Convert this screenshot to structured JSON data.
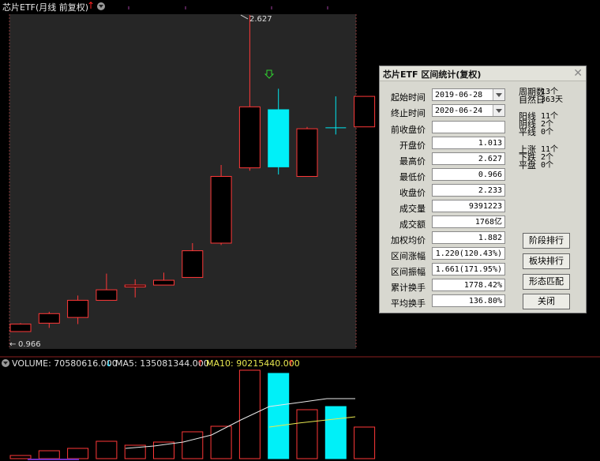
{
  "header": {
    "title": "芯片ETF(月线 前复权)"
  },
  "chart": {
    "high_label": "2.627",
    "low_label": "0.966"
  },
  "chart_data": {
    "type": "candlestick",
    "price_candles": [
      {
        "o": 0.966,
        "c": 1.005,
        "h": 1.01,
        "l": 0.966
      },
      {
        "o": 1.01,
        "c": 1.06,
        "h": 1.07,
        "l": 0.985
      },
      {
        "o": 1.04,
        "c": 1.13,
        "h": 1.155,
        "l": 1.005
      },
      {
        "o": 1.13,
        "c": 1.185,
        "h": 1.27,
        "l": 1.13
      },
      {
        "o": 1.2,
        "c": 1.21,
        "h": 1.24,
        "l": 1.145
      },
      {
        "o": 1.21,
        "c": 1.235,
        "h": 1.275,
        "l": 1.21
      },
      {
        "o": 1.25,
        "c": 1.39,
        "h": 1.43,
        "l": 1.25
      },
      {
        "o": 1.43,
        "c": 1.78,
        "h": 1.84,
        "l": 1.42
      },
      {
        "o": 1.825,
        "c": 2.145,
        "h": 2.627,
        "l": 1.81
      },
      {
        "o": 2.13,
        "c": 1.83,
        "h": 2.24,
        "l": 1.79
      },
      {
        "o": 1.78,
        "c": 2.03,
        "h": 2.04,
        "l": 1.78
      },
      {
        "o": 2.035,
        "c": 2.033,
        "h": 2.2,
        "l": 2.0
      },
      {
        "o": 2.04,
        "c": 2.2,
        "h": 2.2,
        "l": 2.04
      }
    ],
    "volume": {
      "label": "VOLUME: 70580616.000",
      "ma5_label": "MA5: 135081344.000",
      "ma10_label": "MA10: 90215440.000"
    }
  },
  "dialog": {
    "title": "芯片ETF 区间统计(复权)",
    "fields": [
      {
        "label": "起始时间",
        "value": "2019-06-28",
        "combo": true
      },
      {
        "label": "终止时间",
        "value": "2020-06-24",
        "combo": true
      },
      {
        "label": "前收盘价",
        "value": ""
      },
      {
        "label": "开盘价",
        "value": "1.013"
      },
      {
        "label": "最高价",
        "value": "2.627"
      },
      {
        "label": "最低价",
        "value": "0.966"
      },
      {
        "label": "收盘价",
        "value": "2.233"
      },
      {
        "label": "成交量",
        "value": "9391223"
      },
      {
        "label": "成交额",
        "value": "1768亿"
      },
      {
        "label": "加权均价",
        "value": "1.882"
      },
      {
        "label": "区间涨幅",
        "value": "1.220(120.43%)"
      },
      {
        "label": "区间振幅",
        "value": "1.661(171.95%)"
      },
      {
        "label": "累计换手",
        "value": "1778.42%"
      },
      {
        "label": "平均换手",
        "value": "136.80%"
      }
    ],
    "stats": [
      {
        "label": "周期数",
        "value": "13个"
      },
      {
        "label": "自然日",
        "value": "363天"
      },
      {
        "label": "阳线",
        "value": "11个"
      },
      {
        "label": "阴线",
        "value": "2个"
      },
      {
        "label": "平线",
        "value": "0个"
      },
      {
        "label": "上涨",
        "value": "11个"
      },
      {
        "label": "下跌",
        "value": "2个"
      },
      {
        "label": "平盘",
        "value": "0个"
      }
    ],
    "buttons": [
      "阶段排行",
      "板块排行",
      "形态匹配",
      "关闭"
    ]
  }
}
